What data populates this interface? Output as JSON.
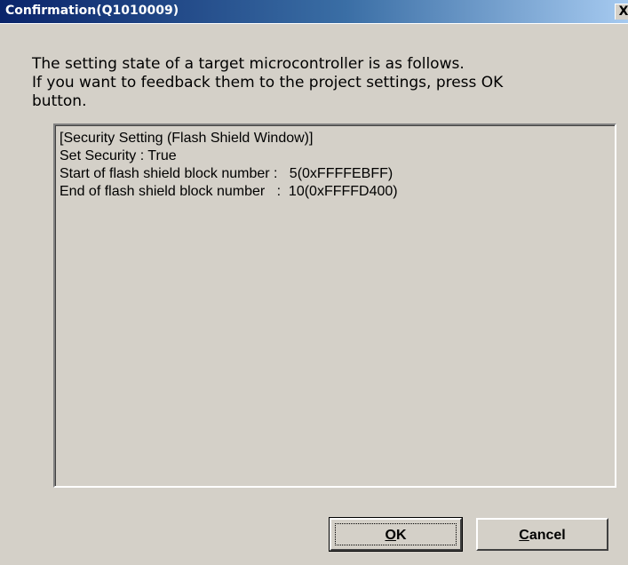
{
  "window": {
    "title": "Confirmation(Q1010009)",
    "close_glyph": "X",
    "colors": {
      "titlebar_start": "#0a246a",
      "titlebar_end": "#a6caf0",
      "face": "#d4d0c8"
    }
  },
  "message": {
    "lines": [
      "The setting state of a target microcontroller is as follows.",
      "If you want to feedback them to the project settings, press OK",
      "button."
    ]
  },
  "details": {
    "lines": [
      "[Security Setting (Flash Shield Window)]",
      "Set Security : True",
      "Start of flash shield block number :   5(0xFFFFEBFF)",
      "End of flash shield block number   :  10(0xFFFFD400)"
    ]
  },
  "buttons": {
    "ok": {
      "mnemonic": "O",
      "rest": "K"
    },
    "cancel": {
      "mnemonic": "C",
      "rest": "ancel"
    }
  }
}
